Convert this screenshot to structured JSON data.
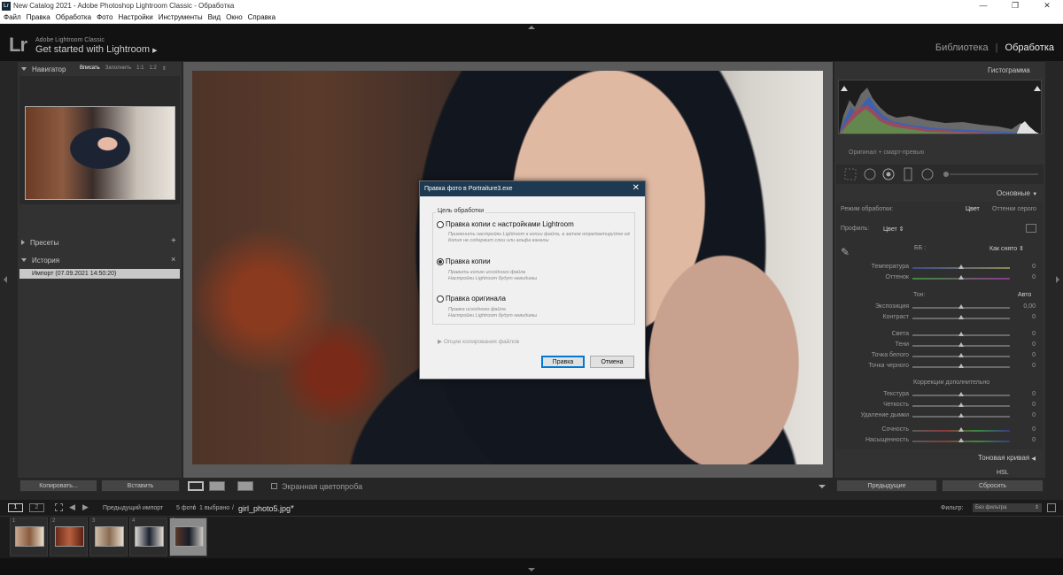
{
  "window": {
    "title": "New Catalog 2021 - Adobe Photoshop Lightroom Classic - Обработка",
    "app_icon": "Lr",
    "controls": [
      "—",
      "❐",
      "✕"
    ]
  },
  "menu": [
    "Файл",
    "Правка",
    "Обработка",
    "Фото",
    "Настройки",
    "Инструменты",
    "Вид",
    "Окно",
    "Справка"
  ],
  "identity": {
    "logo": "Lr",
    "product": "Adobe Lightroom Classic",
    "tagline": "Get started with Lightroom",
    "tagline_arrow": "▶"
  },
  "modules": {
    "library": "Библиотека",
    "separator": "|",
    "develop": "Обработка"
  },
  "left_panel": {
    "navigator": {
      "title": "Навигатор",
      "options": [
        "Вписать",
        "Заполнить",
        "1:1",
        "1:2"
      ],
      "active_option": "Вписать",
      "option_arrow": "⇕"
    },
    "presets": {
      "title": "Пресеты",
      "add": "+"
    },
    "history": {
      "title": "История",
      "close": "×",
      "item": "Импорт (07.09.2021 14:50:20)"
    },
    "copy_button": "Копировать...",
    "paste_button": "Вставить"
  },
  "center_toolbar": {
    "soft_proof_label": "Экранная цветопроба"
  },
  "right_panel": {
    "histogram_title": "Гистограмма",
    "histogram_caption": "Оригинал + смарт-превью",
    "basic_title": "Основные",
    "treatment_label": "Режим обработки:",
    "treatment_color": "Цвет",
    "treatment_bw": "Оттенки серого",
    "profile_label": "Профиль:",
    "profile_value": "Цвет",
    "wb_label": "ББ :",
    "wb_value": "Как снято",
    "tone_label": "Тон:",
    "auto_label": "Авто",
    "presence_label": "Коррекции дополнительно",
    "sliders": [
      {
        "label": "Температура",
        "value": "0"
      },
      {
        "label": "Оттенок",
        "value": "0"
      },
      {
        "label": "Экспозиция",
        "value": "0,00"
      },
      {
        "label": "Контраст",
        "value": "0"
      },
      {
        "label": "Света",
        "value": "0"
      },
      {
        "label": "Тени",
        "value": "0"
      },
      {
        "label": "Точка белого",
        "value": "0"
      },
      {
        "label": "Точка черного",
        "value": "0"
      },
      {
        "label": "Текстура",
        "value": "0"
      },
      {
        "label": "Четкость",
        "value": "0"
      },
      {
        "label": "Удаление дымки",
        "value": "0"
      },
      {
        "label": "Сочность",
        "value": "0"
      },
      {
        "label": "Насыщенность",
        "value": "0"
      }
    ],
    "tone_curve_title": "Тоновая кривая",
    "hsl_title": "HSL",
    "previous_button": "Предыдущие",
    "reset_button": "Сбросить"
  },
  "filmstrip": {
    "prev_import": "Предыдущий импорт",
    "count": "5 фото",
    "separator": "/",
    "selected": "1 выбрано",
    "path_sep": "/",
    "filename": "girl_photo5.jpg",
    "filename_arrow": "▼",
    "filter_label": "Фильтр:",
    "filter_value": "Без фильтра",
    "page1": "1",
    "page2": "2",
    "tile_numbers": [
      "1",
      "2",
      "3",
      "4",
      "5"
    ]
  },
  "dialog": {
    "title": "Правка фото в Portraiture3.exe",
    "close": "✕",
    "group_label": "Цель обработки",
    "options": [
      {
        "label": "Правка копии с настройками Lightroom",
        "desc1": "Применить настройки Lightroom к копии файла, а затем отредактируйте её",
        "desc2": "Копия не содержит слои или альфа каналы"
      },
      {
        "label": "Правка копии",
        "desc1": "Править копию исходного файла",
        "desc2": "Настройки Lightroom будут невидимы"
      },
      {
        "label": "Правка оригинала",
        "desc1": "Правка исходного файла",
        "desc2": "Настройки Lightroom будут невидимы"
      }
    ],
    "selected_option_index": 1,
    "copy_options": "Опции копирования файлов",
    "ok_button": "Правка",
    "cancel_button": "Отмена"
  },
  "colors": {
    "dialog_titlebar": "#1e3a52",
    "focus_border": "#0078d7",
    "panel_bg": "#323232"
  }
}
